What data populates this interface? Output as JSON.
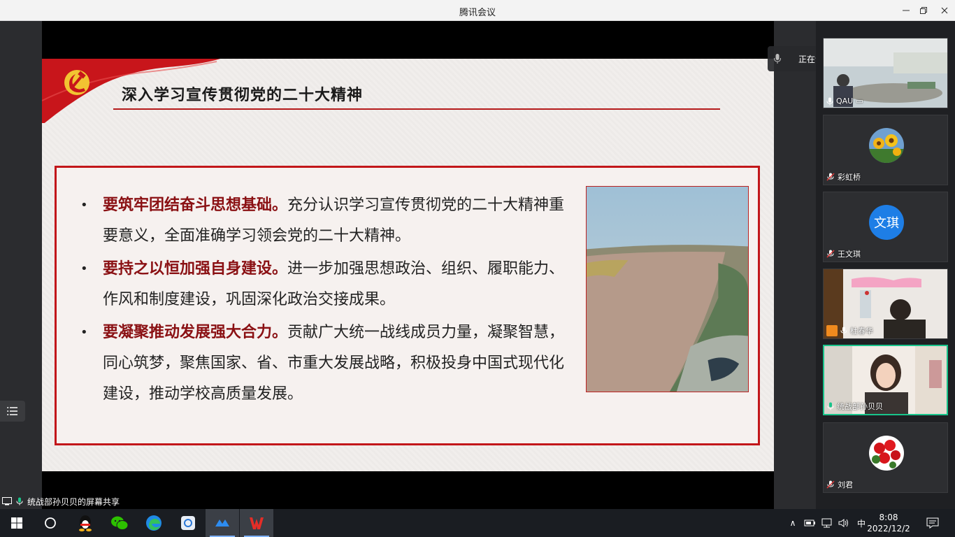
{
  "window": {
    "title": "腾讯会议"
  },
  "speaker_toast": {
    "text": "正在讲话: 统战部孙贝贝;"
  },
  "slide": {
    "title": "深入学习宣传贯彻党的二十大精神",
    "bullets": [
      {
        "bold": "要筑牢团结奋斗思想基础。",
        "text": "充分认识学习宣传贯彻党的二十大精神重要意义，全面准确学习领会党的二十大精神。"
      },
      {
        "bold": "要持之以恒加强自身建设。",
        "text": "进一步加强思想政治、组织、履职能力、作风和制度建设，巩固深化政治交接成果。"
      },
      {
        "bold": "要凝聚推动发展强大合力。",
        "text": "贡献广大统一战线成员力量，凝聚智慧，同心筑梦，聚焦国家、省、市重大发展战略，积极投身中国式现代化建设，推动学校高质量发展。"
      }
    ]
  },
  "participants": [
    {
      "name": "QAU",
      "extra": "▭",
      "mic": "on"
    },
    {
      "name": "彩虹桥",
      "mic": "muted"
    },
    {
      "name": "王文琪",
      "avatar_text": "文琪",
      "mic": "muted"
    },
    {
      "name": "杜春华",
      "mic": "on"
    },
    {
      "name": "统战部孙贝贝",
      "mic": "speaking"
    },
    {
      "name": "刘君",
      "mic": "muted"
    }
  ],
  "share_label": "统战部孙贝贝的屏幕共享",
  "taskbar": {
    "ime": "中",
    "time": "8:08",
    "date": "2022/12/2"
  },
  "colors": {
    "accent_red": "#c2161a",
    "active_green": "#19c48b"
  }
}
